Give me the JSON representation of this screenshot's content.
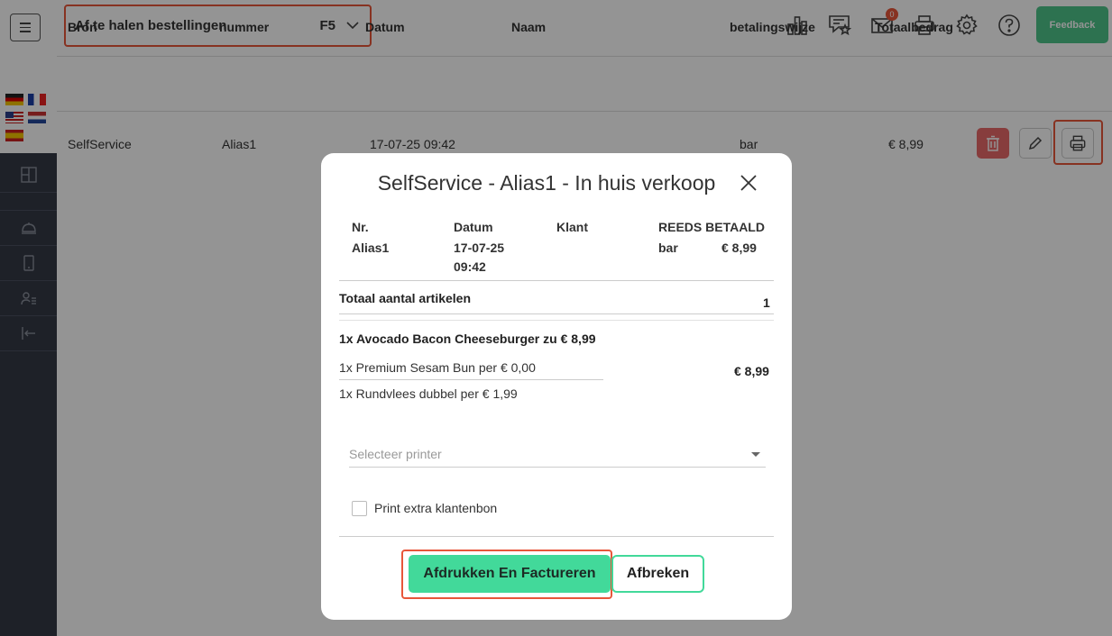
{
  "header": {
    "dropdown_label": "Af te halen bestellingen",
    "dropdown_key": "F5",
    "mail_badge": "0",
    "feedback_label": "Feedback"
  },
  "icons": {
    "menu": "hamburger-icon",
    "chart": "bar-chart-icon",
    "reviews": "review-star-icon",
    "mail": "mail-icon",
    "printer": "printer-icon",
    "settings": "gear-icon",
    "help": "help-circle-icon"
  },
  "table": {
    "headers": [
      "Bron",
      "nummer",
      "Datum",
      "Naam",
      "betalingswijze",
      "Totaalbedrag"
    ],
    "rows": [
      {
        "bron": "SelfService",
        "nummer": "Alias1",
        "datum": "17-07-25 09:42",
        "naam": "",
        "betalingswijze": "bar",
        "totaal": "€ 8,99"
      }
    ]
  },
  "modal": {
    "title": "SelfService - Alias1 - In huis verkoop",
    "nr_label": "Nr.",
    "nr_value": "Alias1",
    "datum_label": "Datum",
    "datum_value_date": "17-07-25",
    "datum_value_time": "09:42",
    "klant_label": "Klant",
    "paid_label": "REEDS BETAALD",
    "paid_method": "bar",
    "paid_amount": "€ 8,99",
    "total_items_label": "Totaal aantal artikelen",
    "total_items_value": "1",
    "item_main": "1x Avocado Bacon Cheeseburger zu € 8,99",
    "item_price": "€ 8,99",
    "sub_items": [
      "1x Premium Sesam Bun per € 0,00",
      "1x Rundvlees dubbel per € 1,99"
    ],
    "printer_placeholder": "Selecteer printer",
    "extra_receipt_label": "Print extra klantenbon",
    "primary_button": "Afdrukken En Factureren",
    "secondary_button": "Afbreken"
  },
  "colors": {
    "accent": "#42d99a",
    "highlight": "#e8563a",
    "sidebar": "#343a46",
    "delete": "#e86a6a"
  }
}
